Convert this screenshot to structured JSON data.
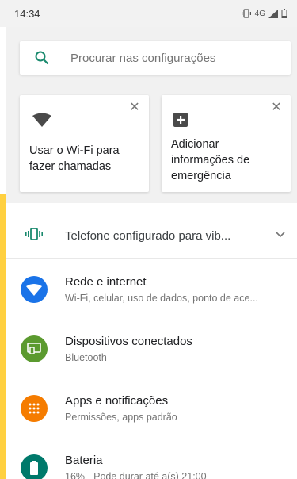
{
  "status_bar": {
    "time": "14:34",
    "network": "4G"
  },
  "search": {
    "placeholder": "Procurar nas configurações"
  },
  "cards": [
    {
      "text": "Usar o Wi-Fi para fazer chamadas"
    },
    {
      "text": "Adicionar informações de emergência"
    }
  ],
  "suggestion": {
    "label": "Telefone configurado para vib..."
  },
  "settings": [
    {
      "title": "Rede e internet",
      "subtitle": "Wi-Fi, celular, uso de dados, ponto de ace...",
      "color": "#1a73e8"
    },
    {
      "title": "Dispositivos conectados",
      "subtitle": "Bluetooth",
      "color": "#5b9a2f"
    },
    {
      "title": "Apps e notificações",
      "subtitle": "Permissões, apps padrão",
      "color": "#f57c00"
    },
    {
      "title": "Bateria",
      "subtitle": "16% - Pode durar até a(s) 21:00",
      "color": "#00796b"
    }
  ],
  "colors": {
    "accent": "#1a8a6e",
    "highlight_bar": "#ffd040"
  }
}
